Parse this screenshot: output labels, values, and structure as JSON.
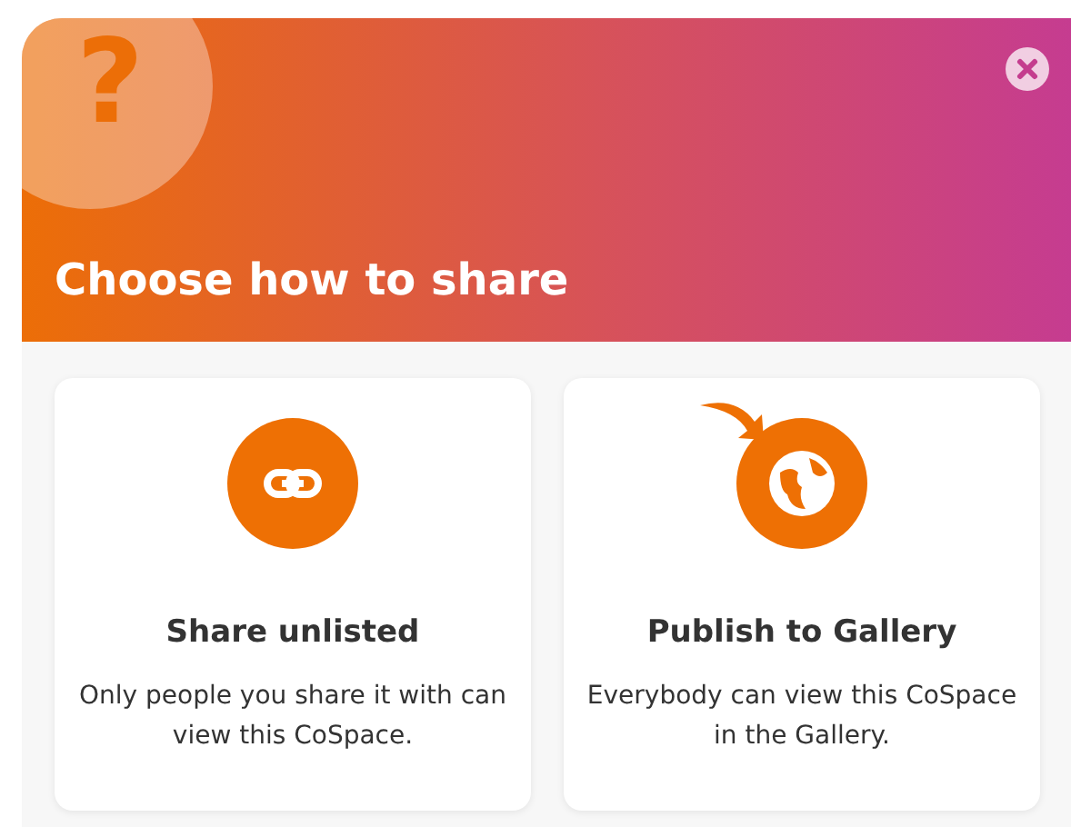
{
  "header": {
    "glyph": "?",
    "title": "Choose how to share"
  },
  "options": [
    {
      "kind": "link",
      "title": "Share unlisted",
      "description": "Only people you share it with can view this CoSpace."
    },
    {
      "kind": "globe",
      "title": "Publish to Gallery",
      "description": "Everybody can view this CoSpace in the Gallery."
    }
  ]
}
